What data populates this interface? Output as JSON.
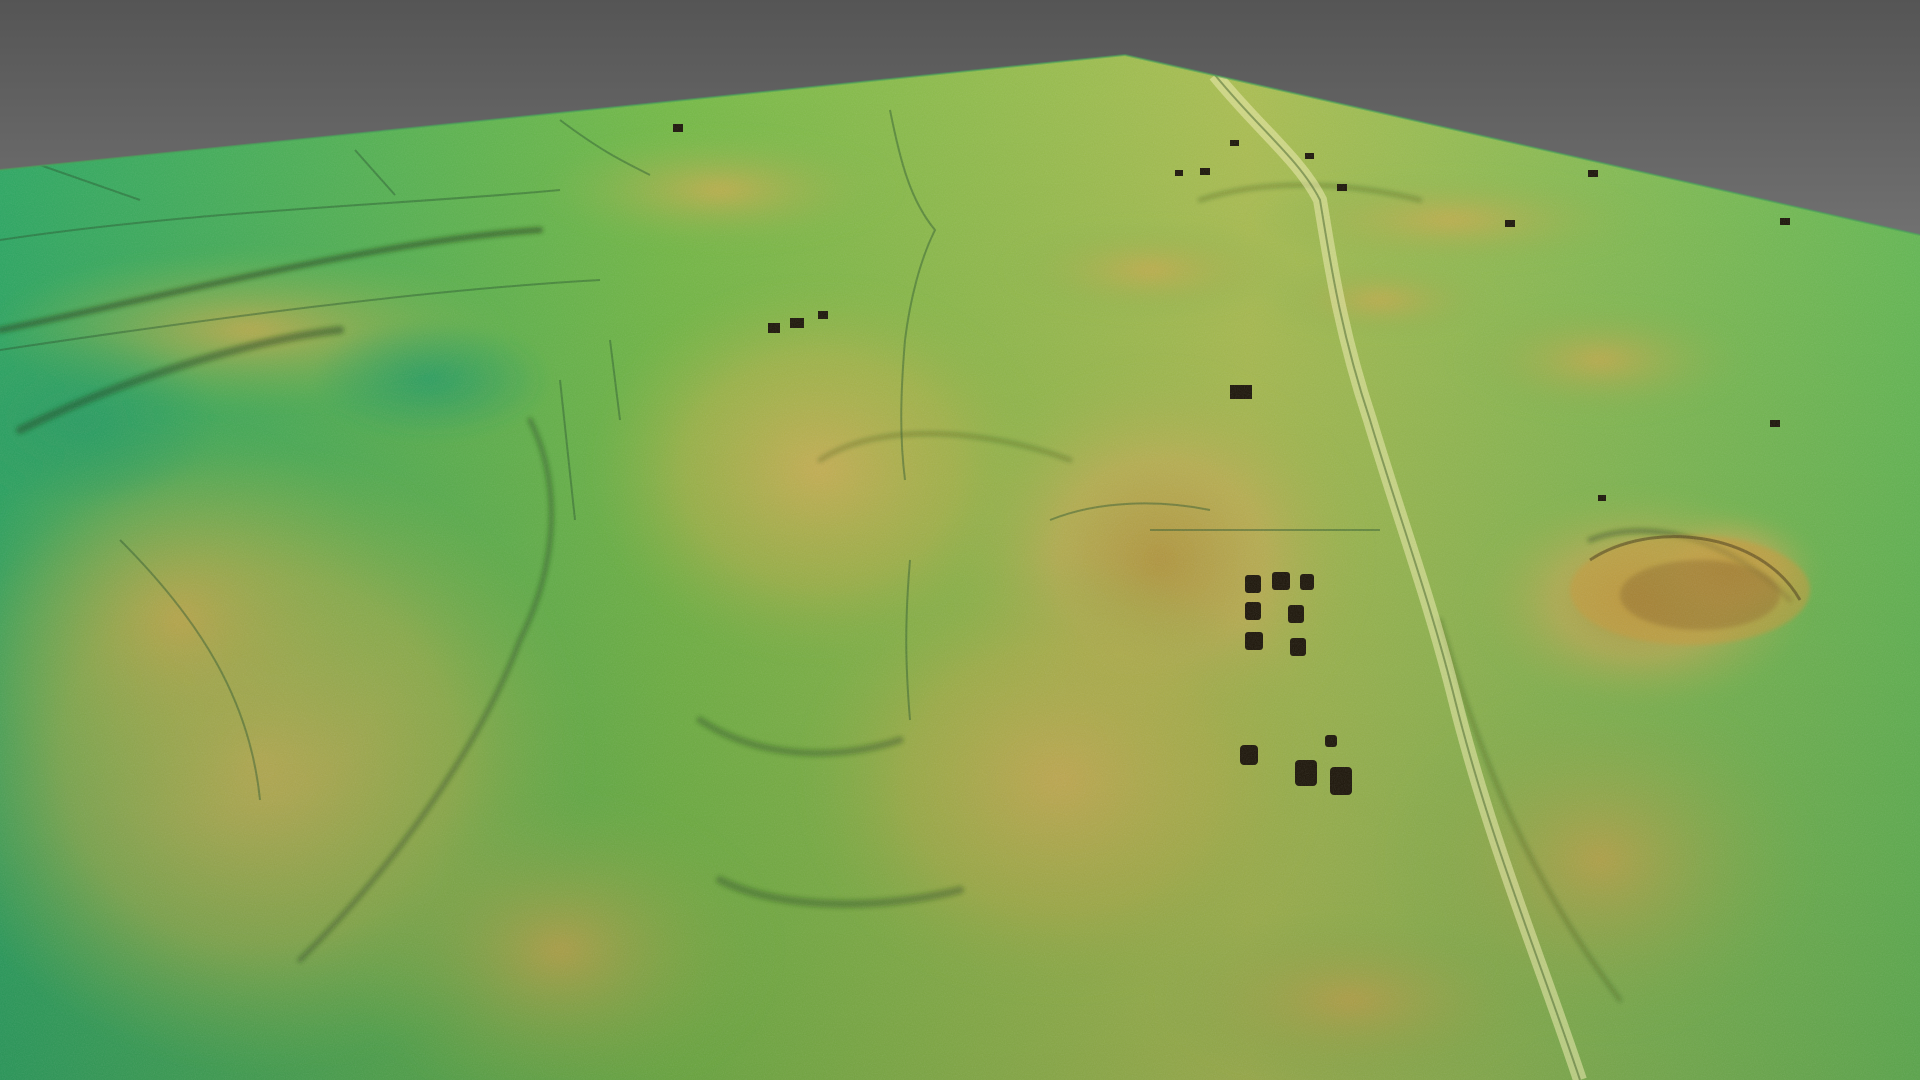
{
  "scene": {
    "description_visible_text": "",
    "colors": {
      "sky_top": "#555555",
      "sky_bottom": "#cfcfcf",
      "terrain_low": "#2fb56a",
      "terrain_mid": "#7cc74a",
      "terrain_high": "#d9c25a",
      "terrain_peak": "#b98a2a",
      "shadow": "#1d3a12",
      "road": "#cfd59a"
    }
  }
}
